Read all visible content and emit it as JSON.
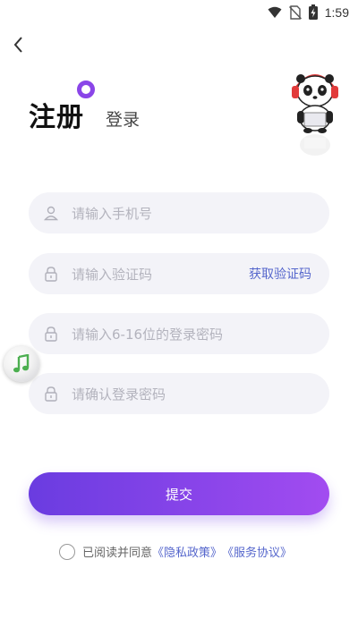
{
  "status_bar": {
    "time": "1:59",
    "icons": [
      "wifi-icon",
      "no-sim-icon",
      "battery-charging-icon"
    ]
  },
  "nav": {
    "back_icon": "chevron-left-icon"
  },
  "tabs": {
    "register": "注册",
    "login": "登录",
    "accent_color": "#8a45e8"
  },
  "mascot": {
    "icon": "panda-headphones-icon"
  },
  "form": {
    "phone": {
      "placeholder": "请输入手机号",
      "icon": "user-icon"
    },
    "code": {
      "placeholder": "请输入验证码",
      "icon": "lock-icon",
      "action": "获取验证码"
    },
    "password": {
      "placeholder": "请输入6-16位的登录密码",
      "icon": "lock-icon"
    },
    "confirm": {
      "placeholder": "请确认登录密码",
      "icon": "lock-icon"
    }
  },
  "floating": {
    "icon": "music-note-icon"
  },
  "submit": {
    "label": "提交"
  },
  "agreement": {
    "text": "已阅读并同意",
    "privacy": "《隐私政策》",
    "service": "《服务协议》",
    "link_color": "#5566cc"
  }
}
